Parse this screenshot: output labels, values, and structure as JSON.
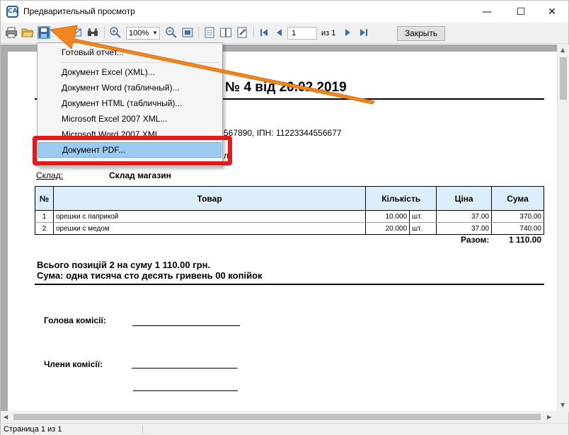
{
  "window": {
    "title": "Предварительный просмотр",
    "app_icon_text": "CA",
    "minimize_glyph": "—",
    "maximize_glyph": "☐",
    "close_glyph": "✕"
  },
  "toolbar": {
    "icons": [
      "print-icon",
      "open-folder-icon",
      "save-icon",
      "email-icon",
      "find-icon",
      "zoom-in-icon",
      "zoom-out-icon",
      "page-view-icon",
      "single-page-icon",
      "two-pages-icon",
      "settings-icon",
      "first-page-icon",
      "prev-page-icon",
      "next-page-icon",
      "last-page-icon"
    ],
    "zoom_value": "100%",
    "page_value": "1",
    "page_of_label": "из 1",
    "close_label": "Закрыть"
  },
  "menu": {
    "items": [
      "Готовый отчет...",
      "Документ Excel (XML)...",
      "Документ Word (табличный)...",
      "Документ HTML (табличный)...",
      "Microsoft Excel 2007 XML...",
      "Microsoft Word 2007 XML...",
      "Документ PDF..."
    ],
    "highlighted": "Документ PDF..."
  },
  "document": {
    "title_visible": "№ 4 від 20.02.2019",
    "codes_line": "567890, ІПН: 11223344556677",
    "line_fragment": "л.",
    "warehouse_label": "Склад:",
    "warehouse_value": "Склад магазин",
    "table": {
      "headers": [
        "№",
        "Товар",
        "Кількість",
        "",
        "Ціна",
        "Сума"
      ],
      "rows": [
        [
          "1",
          "орешки с паприкой",
          "10.000",
          "шт.",
          "37.00",
          "370.00"
        ],
        [
          "2",
          "орешки с медом",
          "20.000",
          "шт.",
          "37.00",
          "740.00"
        ]
      ]
    },
    "total_label": "Разом:",
    "total_value": "1 110.00",
    "summary_line1": "Всього позицій 2 на суму 1 110.00 грн.",
    "summary_line2": "Сума: одна тисяча сто десять гривень 00 копійок",
    "head_label": "Голова комісії:",
    "members_label": "Члени комісії:"
  },
  "status": {
    "text": "Страница 1 из 1"
  },
  "colors": {
    "arrow": "#f0871e",
    "highlight_box": "#e51b1b",
    "menu_highlight": "#9ccbf2",
    "table_header": "#ddeefb"
  }
}
